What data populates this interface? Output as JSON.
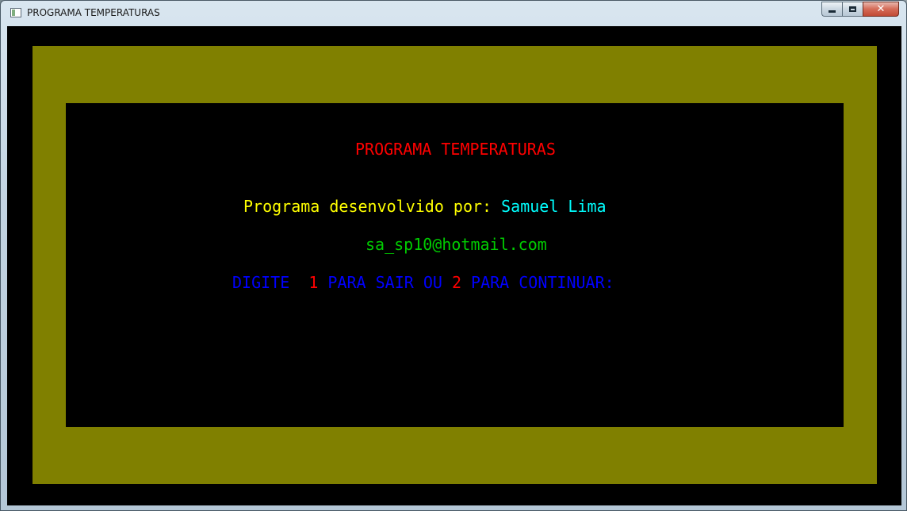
{
  "window": {
    "title": "PROGRAMA TEMPERATURAS",
    "controls": {
      "minimize_icon": "minimize-icon",
      "maximize_icon": "maximize-icon",
      "close_glyph": "✕"
    }
  },
  "console": {
    "heading": "PROGRAMA TEMPERATURAS",
    "credit_prefix": "Programa desenvolvido por: ",
    "credit_name": "Samuel Lima",
    "email": "sa_sp10@hotmail.com",
    "prompt": {
      "part1": "DIGITE  ",
      "option1": "1",
      "part2": " PARA SAIR OU ",
      "option2": "2",
      "part3": " PARA CONTINUAR:"
    }
  },
  "colors": {
    "background": "#000000",
    "frame": "#808000",
    "heading": "#ff0000",
    "credit_prefix": "#ffff00",
    "credit_name": "#00ffff",
    "email": "#00cc00",
    "prompt": "#0000ff",
    "options": "#ff0000"
  }
}
